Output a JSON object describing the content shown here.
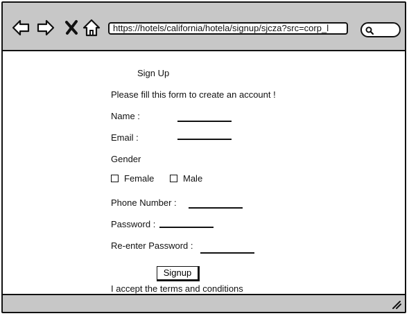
{
  "browser": {
    "url": "https://hotels/california/hotela/signup/sjcza?src=corp_l",
    "icons": {
      "back": "back-arrow-icon",
      "forward": "forward-arrow-icon",
      "stop": "close-icon",
      "home": "home-icon",
      "search": "search-icon",
      "resize": "resize-grip-icon"
    }
  },
  "form": {
    "title": "Sign Up",
    "instructions": "Please fill this form to create an account !",
    "name_label": "Name :",
    "email_label": "Email :",
    "gender_label": "Gender",
    "gender_options": [
      "Female",
      "Male"
    ],
    "phone_label": "Phone Number :",
    "password_label": "Password :",
    "reenter_password_label": "Re-enter Password :",
    "submit_label": "Signup",
    "terms_text": "I accept the terms and conditions"
  }
}
